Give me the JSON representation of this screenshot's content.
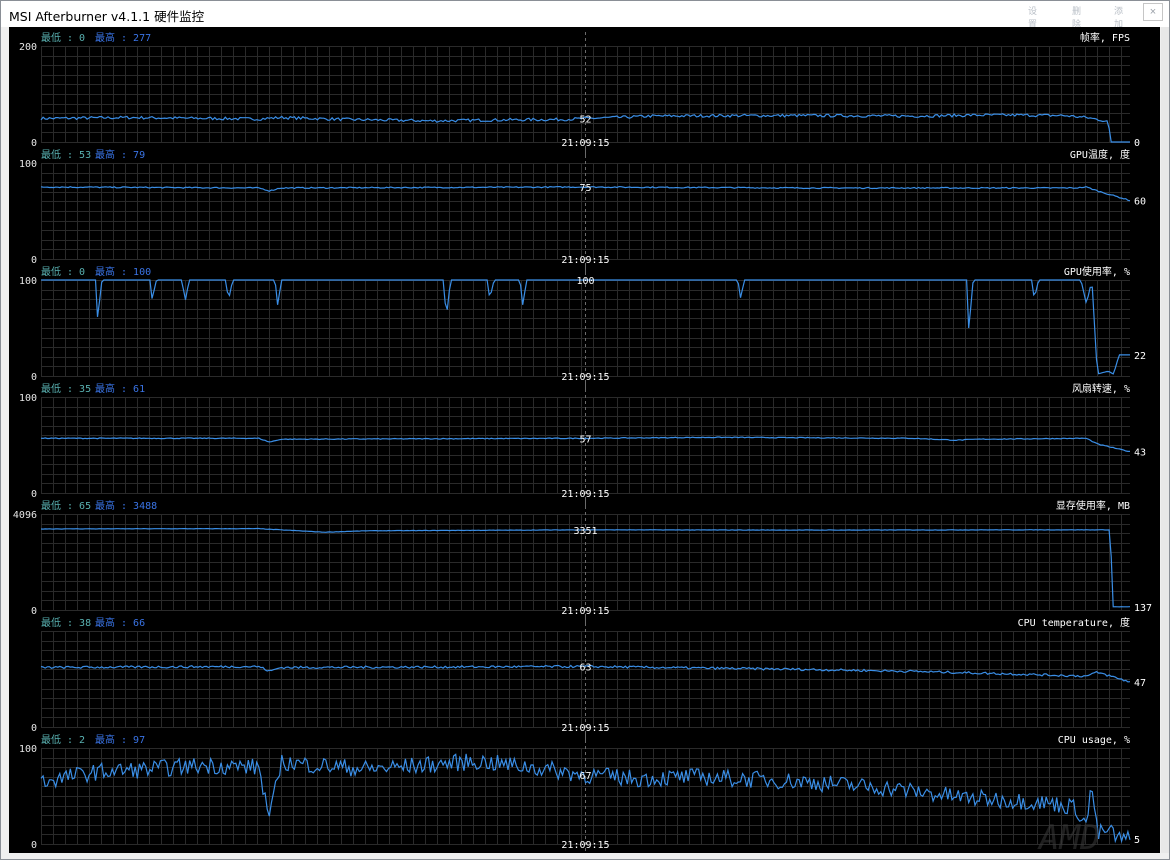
{
  "window": {
    "title": "MSI Afterburner v4.1.1 硬件监控",
    "controls": [
      "设置",
      "删除",
      "添加"
    ],
    "close_glyph": "×"
  },
  "colors": {
    "line": "#3a8ee6",
    "min_label": "#59b1b1",
    "max_label": "#3a74e6",
    "text": "#e6e6e6",
    "grid": "#2a2a2a",
    "cursor": "#6a6a6a"
  },
  "watermark": "AMD",
  "graphs": [
    {
      "name": "fps",
      "title": "帧率, FPS",
      "min_label": "最低 : 0",
      "max_label": "最高 : 277",
      "y_top": "200",
      "y_bottom": "0",
      "range": [
        0,
        200
      ],
      "cursor_value": "52",
      "cursor_time": "21:09:15",
      "current_value": "0",
      "points": [
        [
          0,
          49
        ],
        [
          0.08,
          51
        ],
        [
          0.16,
          49
        ],
        [
          0.2,
          48
        ],
        [
          0.22,
          51
        ],
        [
          0.28,
          47
        ],
        [
          0.36,
          44
        ],
        [
          0.42,
          46
        ],
        [
          0.48,
          47
        ],
        [
          0.5,
          49
        ],
        [
          0.54,
          52
        ],
        [
          0.56,
          54
        ],
        [
          0.64,
          55
        ],
        [
          0.72,
          55
        ],
        [
          0.8,
          54
        ],
        [
          0.86,
          56
        ],
        [
          0.9,
          56
        ],
        [
          0.94,
          55
        ],
        [
          0.96,
          51
        ],
        [
          0.98,
          43
        ],
        [
          0.982,
          0
        ],
        [
          1,
          0
        ]
      ],
      "noise": 3,
      "cursor_pos": 0.5
    },
    {
      "name": "gpu-temp",
      "title": "GPU温度, 度",
      "min_label": "最低 : 53",
      "max_label": "最高 : 79",
      "y_top": "100",
      "y_bottom": "0",
      "range": [
        0,
        100
      ],
      "cursor_value": "75",
      "cursor_time": "21:09:15",
      "current_value": "60",
      "points": [
        [
          0,
          75
        ],
        [
          0.2,
          74
        ],
        [
          0.21,
          71
        ],
        [
          0.22,
          74
        ],
        [
          0.5,
          75
        ],
        [
          0.7,
          74
        ],
        [
          0.95,
          74
        ],
        [
          0.96,
          75
        ],
        [
          0.97,
          71
        ],
        [
          1,
          61
        ]
      ],
      "noise": 0.6,
      "cursor_pos": 0.5
    },
    {
      "name": "gpu-usage",
      "title": "GPU使用率, %",
      "min_label": "最低 : 0",
      "max_label": "最高 : 100",
      "y_top": "100",
      "y_bottom": "0",
      "range": [
        0,
        100
      ],
      "cursor_value": "100",
      "cursor_time": "21:09:15",
      "current_value": "22",
      "points": [
        [
          0,
          100
        ],
        [
          0.05,
          100
        ],
        [
          0.052,
          60
        ],
        [
          0.056,
          100
        ],
        [
          0.1,
          100
        ],
        [
          0.102,
          80
        ],
        [
          0.106,
          100
        ],
        [
          0.13,
          100
        ],
        [
          0.132,
          75
        ],
        [
          0.136,
          100
        ],
        [
          0.17,
          100
        ],
        [
          0.172,
          78
        ],
        [
          0.176,
          100
        ],
        [
          0.215,
          100
        ],
        [
          0.217,
          72
        ],
        [
          0.221,
          100
        ],
        [
          0.37,
          100
        ],
        [
          0.372,
          58
        ],
        [
          0.376,
          100
        ],
        [
          0.41,
          100
        ],
        [
          0.412,
          80
        ],
        [
          0.416,
          100
        ],
        [
          0.44,
          100
        ],
        [
          0.442,
          72
        ],
        [
          0.446,
          100
        ],
        [
          0.64,
          100
        ],
        [
          0.642,
          80
        ],
        [
          0.646,
          100
        ],
        [
          0.85,
          100
        ],
        [
          0.852,
          48
        ],
        [
          0.856,
          100
        ],
        [
          0.91,
          100
        ],
        [
          0.912,
          80
        ],
        [
          0.916,
          100
        ],
        [
          0.955,
          100
        ],
        [
          0.96,
          75
        ],
        [
          0.965,
          100
        ],
        [
          0.97,
          2
        ],
        [
          0.98,
          5
        ],
        [
          0.985,
          2
        ],
        [
          0.99,
          22
        ],
        [
          1,
          22
        ]
      ],
      "noise": 0,
      "cursor_pos": 0.5
    },
    {
      "name": "fan-speed",
      "title": "风扇转速, %",
      "min_label": "最低 : 35",
      "max_label": "最高 : 61",
      "y_top": "100",
      "y_bottom": "0",
      "range": [
        0,
        100
      ],
      "cursor_value": "57",
      "cursor_time": "21:09:15",
      "current_value": "43",
      "points": [
        [
          0,
          57
        ],
        [
          0.2,
          57
        ],
        [
          0.21,
          53
        ],
        [
          0.22,
          56
        ],
        [
          0.5,
          57
        ],
        [
          0.62,
          58
        ],
        [
          0.8,
          57
        ],
        [
          0.84,
          55
        ],
        [
          0.86,
          56
        ],
        [
          0.96,
          57
        ],
        [
          0.97,
          51
        ],
        [
          1,
          43
        ]
      ],
      "noise": 0.4,
      "cursor_pos": 0.5
    },
    {
      "name": "vram-usage",
      "title": "显存使用率, MB",
      "min_label": "最低 : 65",
      "max_label": "最高 : 3488",
      "y_top": "4096",
      "y_bottom": "0",
      "range": [
        0,
        4096
      ],
      "cursor_value": "3351",
      "cursor_time": "21:09:15",
      "current_value": "137",
      "points": [
        [
          0,
          3460
        ],
        [
          0.2,
          3470
        ],
        [
          0.26,
          3320
        ],
        [
          0.3,
          3380
        ],
        [
          0.5,
          3420
        ],
        [
          0.7,
          3410
        ],
        [
          0.9,
          3420
        ],
        [
          0.982,
          3420
        ],
        [
          0.984,
          137
        ],
        [
          1,
          137
        ]
      ],
      "noise": 8,
      "cursor_pos": 0.5
    },
    {
      "name": "cpu-temp",
      "title": "CPU temperature, 度",
      "min_label": "最低 : 38",
      "max_label": "最高 : 66",
      "y_top": "",
      "y_bottom": "0",
      "range": [
        0,
        100
      ],
      "cursor_value": "63",
      "cursor_time": "21:09:15",
      "current_value": "47",
      "points": [
        [
          0,
          62
        ],
        [
          0.2,
          63
        ],
        [
          0.21,
          58
        ],
        [
          0.22,
          62
        ],
        [
          0.5,
          63
        ],
        [
          0.7,
          60
        ],
        [
          0.8,
          58
        ],
        [
          0.9,
          55
        ],
        [
          0.96,
          53
        ],
        [
          0.97,
          57
        ],
        [
          1,
          47
        ]
      ],
      "noise": 1.2,
      "cursor_pos": 0.5
    },
    {
      "name": "cpu-usage",
      "title": "CPU usage, %",
      "min_label": "最低 : 2",
      "max_label": "最高 : 97",
      "y_top": "100",
      "y_bottom": "0",
      "range": [
        0,
        100
      ],
      "cursor_value": "67",
      "cursor_time": "21:09:15",
      "current_value": "5",
      "points": [
        [
          0,
          65
        ],
        [
          0.05,
          75
        ],
        [
          0.1,
          78
        ],
        [
          0.15,
          82
        ],
        [
          0.2,
          80
        ],
        [
          0.21,
          25
        ],
        [
          0.22,
          85
        ],
        [
          0.3,
          78
        ],
        [
          0.4,
          86
        ],
        [
          0.45,
          80
        ],
        [
          0.5,
          72
        ],
        [
          0.55,
          68
        ],
        [
          0.6,
          70
        ],
        [
          0.7,
          65
        ],
        [
          0.78,
          58
        ],
        [
          0.85,
          48
        ],
        [
          0.9,
          45
        ],
        [
          0.93,
          42
        ],
        [
          0.95,
          38
        ],
        [
          0.96,
          20
        ],
        [
          0.965,
          62
        ],
        [
          0.97,
          10
        ],
        [
          0.98,
          15
        ],
        [
          0.99,
          5
        ],
        [
          1,
          5
        ]
      ],
      "noise": 9,
      "cursor_pos": 0.5
    }
  ]
}
